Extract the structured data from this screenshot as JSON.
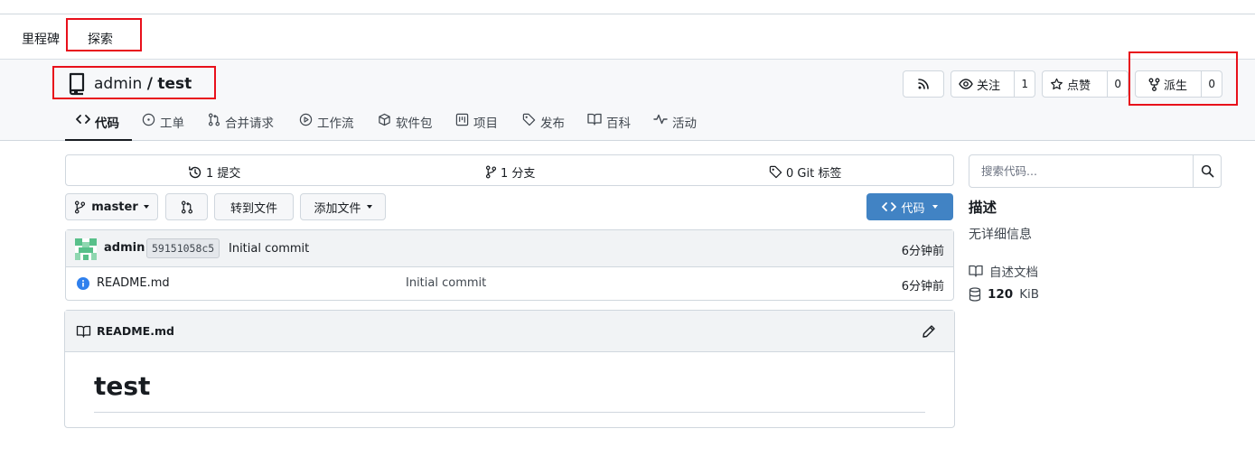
{
  "topnav": {
    "milestones_label": "里程碑",
    "explore_label": "探索"
  },
  "repo": {
    "owner": "admin",
    "separator": "/",
    "name": "test"
  },
  "actions": {
    "watch_label": "关注",
    "watch_count": "1",
    "star_label": "点赞",
    "star_count": "0",
    "fork_label": "派生",
    "fork_count": "0"
  },
  "tabs": [
    {
      "label": "代码",
      "icon": "code-icon"
    },
    {
      "label": "工单",
      "icon": "issue-icon"
    },
    {
      "label": "合并请求",
      "icon": "pull-request-icon"
    },
    {
      "label": "工作流",
      "icon": "play-icon"
    },
    {
      "label": "软件包",
      "icon": "package-icon"
    },
    {
      "label": "项目",
      "icon": "project-icon"
    },
    {
      "label": "发布",
      "icon": "tag-icon"
    },
    {
      "label": "百科",
      "icon": "book-icon"
    },
    {
      "label": "活动",
      "icon": "pulse-icon"
    }
  ],
  "stats": {
    "commits": "1 提交",
    "branches": "1 分支",
    "tags": "0 Git 标签"
  },
  "toolbar": {
    "branch": "master",
    "goto_file": "转到文件",
    "add_file": "添加文件",
    "code": "代码"
  },
  "latest_commit": {
    "author": "admin",
    "sha": "59151058c5",
    "message": "Initial commit",
    "time": "6分钟前"
  },
  "files": [
    {
      "name": "README.md",
      "commit": "Initial commit",
      "time": "6分钟前",
      "icon": "info-icon"
    }
  ],
  "readme": {
    "filename": "README.md",
    "heading": "test"
  },
  "sidebar": {
    "search_placeholder": "搜索代码...",
    "about_title": "描述",
    "about_text": "无详细信息",
    "docs_label": "自述文档",
    "size_value": "120",
    "size_unit": "KiB"
  },
  "colors": {
    "primary_button": "#4183c4",
    "annotation_box": "#e8101b",
    "info_icon": "#2f80ed"
  }
}
